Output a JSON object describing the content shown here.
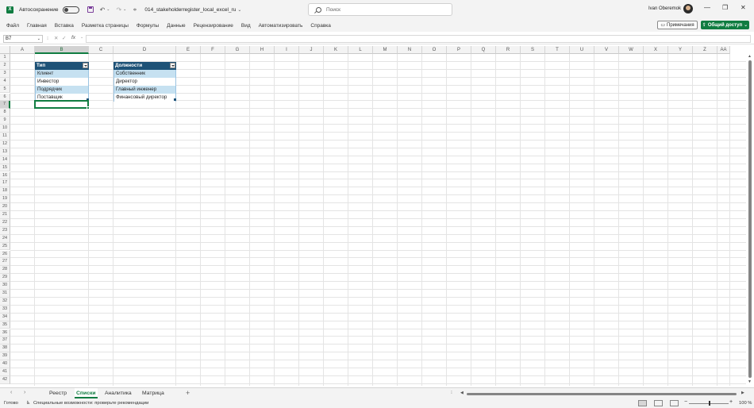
{
  "app": {
    "autosave_label": "Автосохранение",
    "filename": "014_stakeholderregister_local_excel_ru",
    "search_placeholder": "Поиск",
    "username": "Ivan Oberemok"
  },
  "menu": [
    "Файл",
    "Главная",
    "Вставка",
    "Разметка страницы",
    "Формулы",
    "Данные",
    "Рецензирование",
    "Вид",
    "Автоматизировать",
    "Справка"
  ],
  "buttons": {
    "comments": "Примечания",
    "share": "Общий доступ"
  },
  "formula_bar": {
    "name_box": "B7",
    "fx": "fx",
    "formula": ""
  },
  "columns": [
    "A",
    "B",
    "C",
    "D",
    "E",
    "F",
    "G",
    "H",
    "I",
    "J",
    "K",
    "L",
    "M",
    "N",
    "O",
    "P",
    "Q",
    "R",
    "S",
    "T",
    "U",
    "V",
    "W",
    "X",
    "Y",
    "Z",
    "AA"
  ],
  "rows_count": 42,
  "active_cell": "B7",
  "tables": [
    {
      "header": "Тип",
      "items": [
        "Клиент",
        "Инвестор",
        "Подрядчик",
        "Поставщик"
      ]
    },
    {
      "header": "Должности",
      "items": [
        "Собственник",
        "Директор",
        "Главный инженер",
        "Финансовый директор"
      ]
    }
  ],
  "sheets": [
    "Реестр",
    "Списки",
    "Аналитика",
    "Матрица"
  ],
  "active_sheet": "Списки",
  "status": {
    "ready": "Готово",
    "accessibility": "Специальные возможности: проверьте рекомендации",
    "zoom": "100 %"
  },
  "colors": {
    "accent": "#107c41",
    "table_header": "#1e5277",
    "table_band": "#c6e1f1"
  }
}
